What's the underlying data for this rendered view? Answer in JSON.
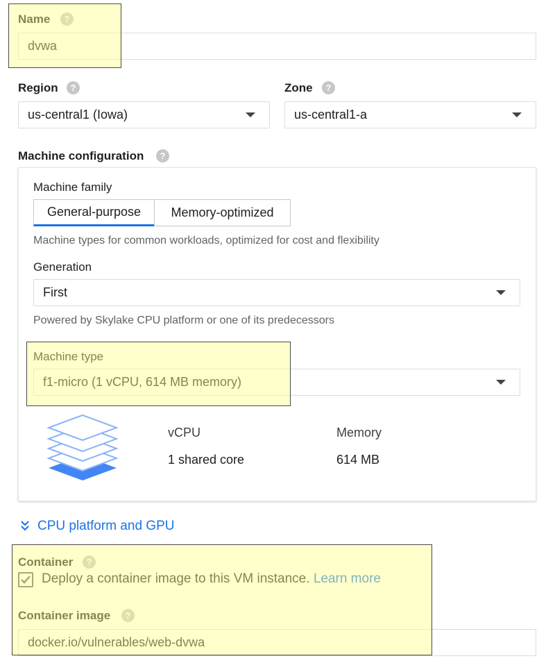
{
  "name": {
    "label": "Name",
    "value": "dvwa"
  },
  "region": {
    "label": "Region",
    "value": "us-central1 (Iowa)"
  },
  "zone": {
    "label": "Zone",
    "value": "us-central1-a"
  },
  "machine_configuration": {
    "label": "Machine configuration",
    "family": {
      "label": "Machine family",
      "tabs": [
        "General-purpose",
        "Memory-optimized"
      ],
      "active_tab": "General-purpose",
      "description": "Machine types for common workloads, optimized for cost and flexibility"
    },
    "generation": {
      "label": "Generation",
      "value": "First",
      "description": "Powered by Skylake CPU platform or one of its predecessors"
    },
    "machine_type": {
      "label": "Machine type",
      "value": "f1-micro (1 vCPU, 614 MB memory)"
    },
    "specs": {
      "vcpu_label": "vCPU",
      "vcpu_value": "1 shared core",
      "memory_label": "Memory",
      "memory_value": "614 MB"
    }
  },
  "cpu_platform": {
    "label": "CPU platform and GPU"
  },
  "container": {
    "label": "Container",
    "checkbox_checked": true,
    "checkbox_label": "Deploy a container image to this VM instance.",
    "learn_more": "Learn more",
    "image_label": "Container image",
    "image_value": "docker.io/vulnerables/web-dvwa"
  },
  "colors": {
    "accent": "#1a73e8",
    "highlight": "#ffff8c",
    "checkbox": "#5f6368"
  }
}
